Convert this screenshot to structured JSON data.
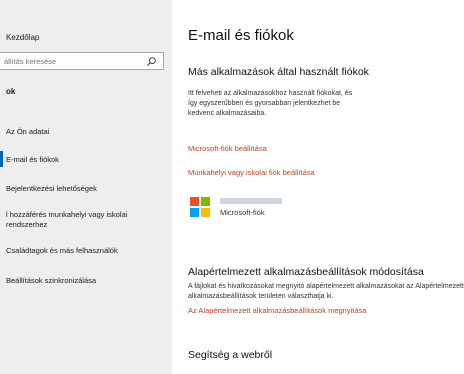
{
  "sidebar": {
    "home_label": "Kezdőlap",
    "search": {
      "placeholder": "állítás keresése",
      "value": ""
    },
    "section_label": "ok",
    "items": [
      {
        "label": "Az Ön adatai"
      },
      {
        "label": "E-mail és fiókok"
      },
      {
        "label": "Bejelentkezési lehetőségek"
      },
      {
        "label": "l hozzáférés munkahelyi vagy iskolai rendszerhez"
      },
      {
        "label": "Családtagok és más felhasználók"
      },
      {
        "label": "Beállítások szinkronizálása"
      }
    ]
  },
  "main": {
    "title": "E-mail és fiókok",
    "other_apps": {
      "heading": "Más alkalmazások által használt fiókok",
      "description": "Itt felveheti az alkalmazásokhoz használt fiókokat, és így egyszerűbben és gyorsabban jelentkezhet be kedvenc alkalmazásaiba.",
      "add_ms_link": "Microsoft-fiók beállítása",
      "add_work_link": "Munkahelyi vagy iskolai fiók beállítása",
      "account": {
        "type": "Microsoft-fiók"
      }
    },
    "defaults": {
      "heading": "Alapértelmezett alkalmazásbeállítások módosítása",
      "description": "A fájlokat és hivatkozásokat megnyitó alapértelmezett alkalmazásokat az Alapértelmezett alkalmazásbeállítások területen választhatja ki.",
      "link": "Az Alapértelmezett alkalmazásbeállítások megnyitása"
    },
    "help": {
      "heading": "Segítség a webről"
    }
  },
  "colors": {
    "accent": "#0063b1",
    "link": "#b7471f",
    "sidebar_bg": "#eeeeee",
    "ms_red": "#f25022",
    "ms_green": "#7fba00",
    "ms_blue": "#00a4ef",
    "ms_yellow": "#ffb900"
  }
}
